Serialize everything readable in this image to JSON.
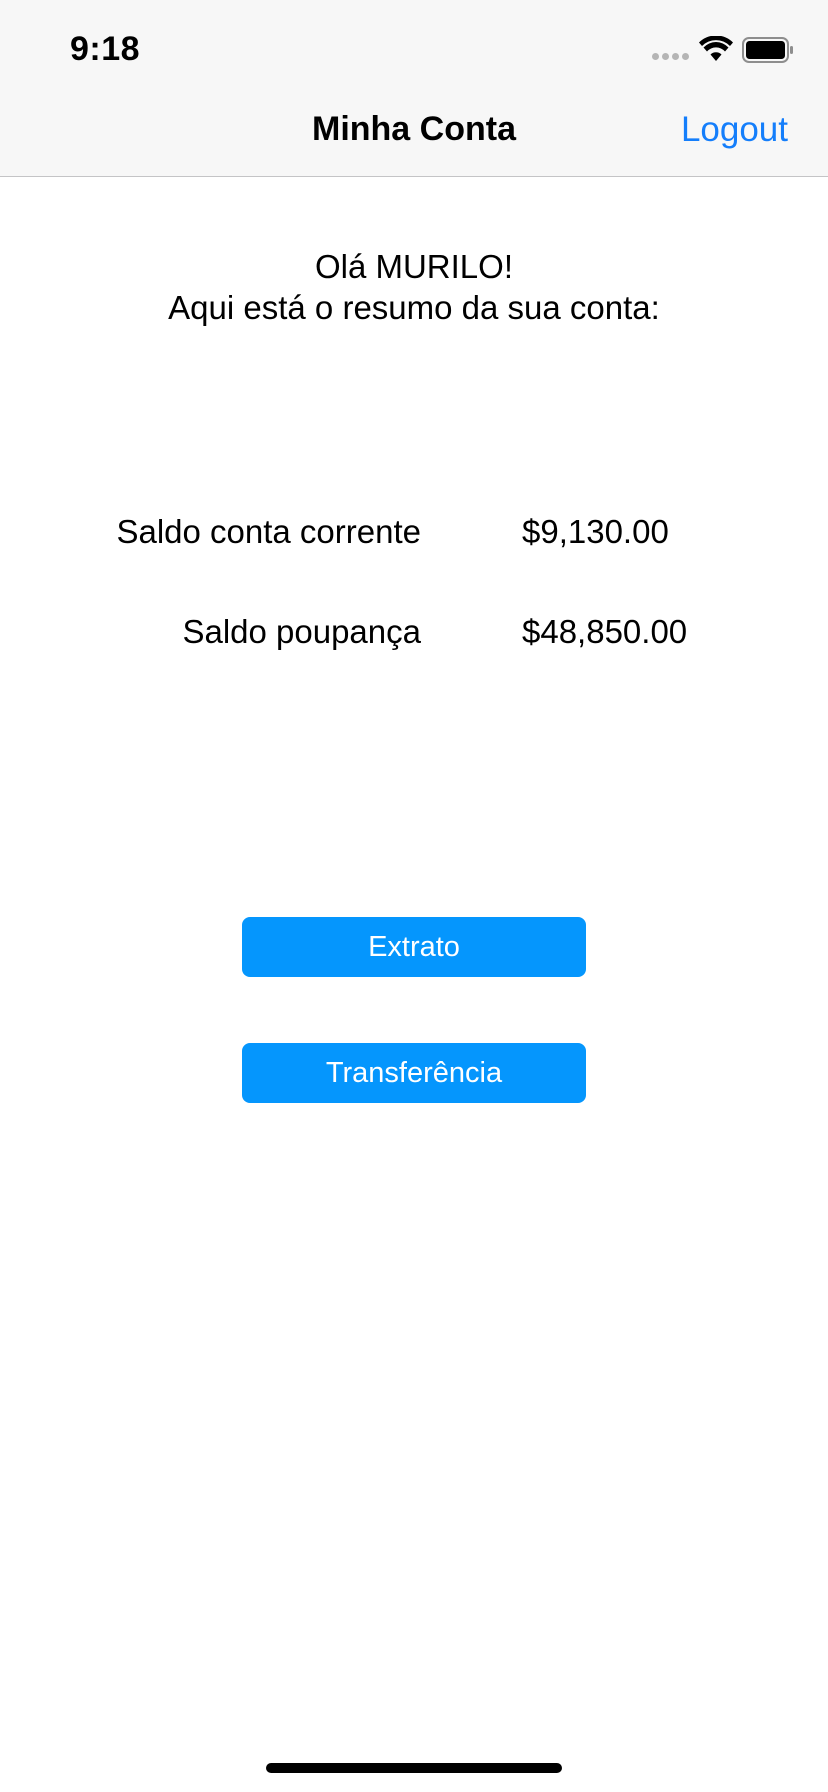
{
  "status_bar": {
    "time": "9:18",
    "icons": [
      "signal-dots-icon",
      "wifi-icon",
      "battery-icon"
    ]
  },
  "nav": {
    "title": "Minha Conta",
    "logout_label": "Logout"
  },
  "greeting": {
    "line1": "Olá MURILO!",
    "line2": "Aqui está o resumo da sua conta:"
  },
  "balances": [
    {
      "label": "Saldo conta corrente",
      "value": "$9,130.00"
    },
    {
      "label": "Saldo poupança",
      "value": "$48,850.00"
    }
  ],
  "actions": {
    "extrato_label": "Extrato",
    "transferencia_label": "Transferência"
  },
  "colors": {
    "accent": "#147efb",
    "button_bg": "#0596fd",
    "nav_bg": "#f7f7f7"
  }
}
